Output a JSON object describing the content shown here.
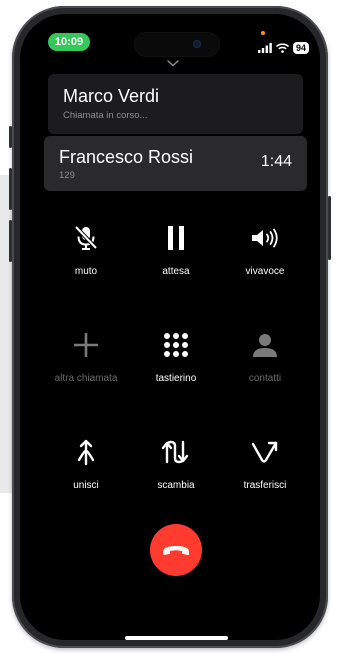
{
  "status_bar": {
    "time": "10:09",
    "battery": "94",
    "icons": [
      "cellular-signal-icon",
      "wifi-icon",
      "battery-icon"
    ]
  },
  "calls": {
    "held": {
      "name": "Marco Verdi",
      "status": "Chiamata in corso..."
    },
    "active": {
      "name": "Francesco Rossi",
      "number": "129",
      "duration": "1:44"
    }
  },
  "controls": [
    {
      "id": "muto",
      "label": "muto",
      "icon": "microphone-off-icon",
      "enabled": true
    },
    {
      "id": "attesa",
      "label": "attesa",
      "icon": "pause-icon",
      "enabled": true
    },
    {
      "id": "vivavoce",
      "label": "vivavoce",
      "icon": "speaker-icon",
      "enabled": true
    },
    {
      "id": "altra_chiamata",
      "label": "altra chiamata",
      "icon": "plus-icon",
      "enabled": false
    },
    {
      "id": "tastierino",
      "label": "tastierino",
      "icon": "keypad-icon",
      "enabled": true
    },
    {
      "id": "contatti",
      "label": "contatti",
      "icon": "contact-icon",
      "enabled": false
    },
    {
      "id": "unisci",
      "label": "unisci",
      "icon": "merge-icon",
      "enabled": true
    },
    {
      "id": "scambia",
      "label": "scambia",
      "icon": "swap-icon",
      "enabled": true
    },
    {
      "id": "trasferisci",
      "label": "trasferisci",
      "icon": "transfer-icon",
      "enabled": true
    }
  ],
  "colors": {
    "end_call": "#ff3b30",
    "status_pill": "#34c759",
    "disabled": "#6b6b6b",
    "background": "#000000"
  }
}
